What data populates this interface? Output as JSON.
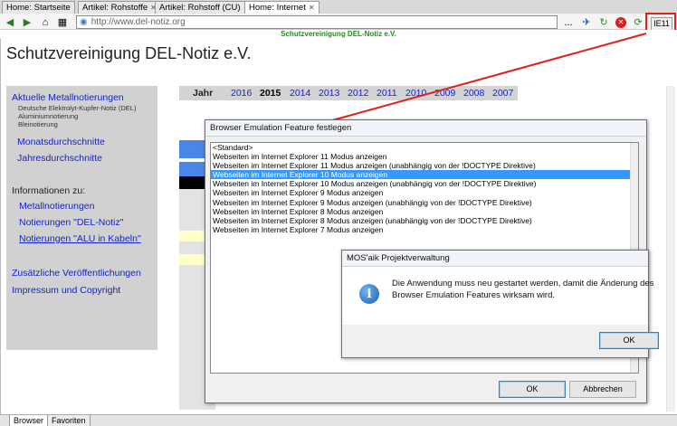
{
  "tabs": [
    {
      "label": "Home: Startseite",
      "closable": false,
      "active": false
    },
    {
      "label": "Artikel: Rohstoffe",
      "closable": true,
      "active": false
    },
    {
      "label": "Artikel: Rohstoff (CU)",
      "closable": true,
      "active": false
    },
    {
      "label": "Home: Internet",
      "closable": true,
      "active": true
    }
  ],
  "toolbar": {
    "url": "http://www.del-notiz.org",
    "more_label": "...",
    "ie_mode_label": "IE11"
  },
  "site": {
    "org_banner": "Schutzvereinigung DEL-Notiz e.V.",
    "title": "Schutzvereinigung DEL-Notiz e.V.",
    "nav": {
      "aktuelle": "Aktuelle Metallnotierungen",
      "sub1": "Deutsche Elektrolyt-Kupfer-Notiz (DEL)",
      "sub2": "Aluminiumnotierung",
      "sub3": "Bleinotierung",
      "monats": "Monatsdurchschnitte",
      "jahres": "Jahresdurchschnitte",
      "info_heading": "Informationen zu:",
      "metall": "Metallnotierungen",
      "del": "Notierungen \"DEL-Notiz\"",
      "alu": "Notierungen \"ALU in Kabeln\"",
      "zusatz": "Zusätzliche Veröffentlichungen",
      "impressum": "Impressum und Copyright"
    },
    "year_label": "Jahr",
    "years": [
      "2016",
      "2015",
      "2014",
      "2013",
      "2012",
      "2011",
      "2010",
      "2009",
      "2008",
      "2007"
    ],
    "current_year": "2015"
  },
  "emulation_dialog": {
    "title": "Browser Emulation Feature festlegen",
    "options": [
      "<Standard>",
      "Webseiten im Internet Explorer 11 Modus anzeigen",
      "Webseiten im Internet Explorer 11 Modus anzeigen (unabhängig von der !DOCTYPE Direktive)",
      "Webseiten im Internet Explorer 10 Modus anzeigen",
      "Webseiten im Internet Explorer 10 Modus anzeigen (unabhängig von der !DOCTYPE Direktive)",
      "Webseiten im Internet Explorer 9 Modus anzeigen",
      "Webseiten im Internet Explorer 9 Modus anzeigen (unabhängig von der !DOCTYPE Direktive)",
      "Webseiten im Internet Explorer 8 Modus anzeigen",
      "Webseiten im Internet Explorer 8 Modus anzeigen (unabhängig von der !DOCTYPE Direktive)",
      "Webseiten im Internet Explorer 7 Modus anzeigen"
    ],
    "selected_index": 3,
    "ok_label": "OK",
    "cancel_label": "Abbrechen"
  },
  "message_dialog": {
    "title": "MOS'aik Projektverwaltung",
    "line1": "Die Anwendung muss neu gestartet werden, damit die Änderung des",
    "line2": "Browser Emulation Features wirksam wird.",
    "ok_label": "OK"
  },
  "bottom_tabs": [
    "Browser",
    "Favoriten"
  ],
  "colors": {
    "link": "#1424c8",
    "selection": "#3399ff",
    "highlight_box": "#e0201c",
    "org_green": "#1d8f1d"
  }
}
